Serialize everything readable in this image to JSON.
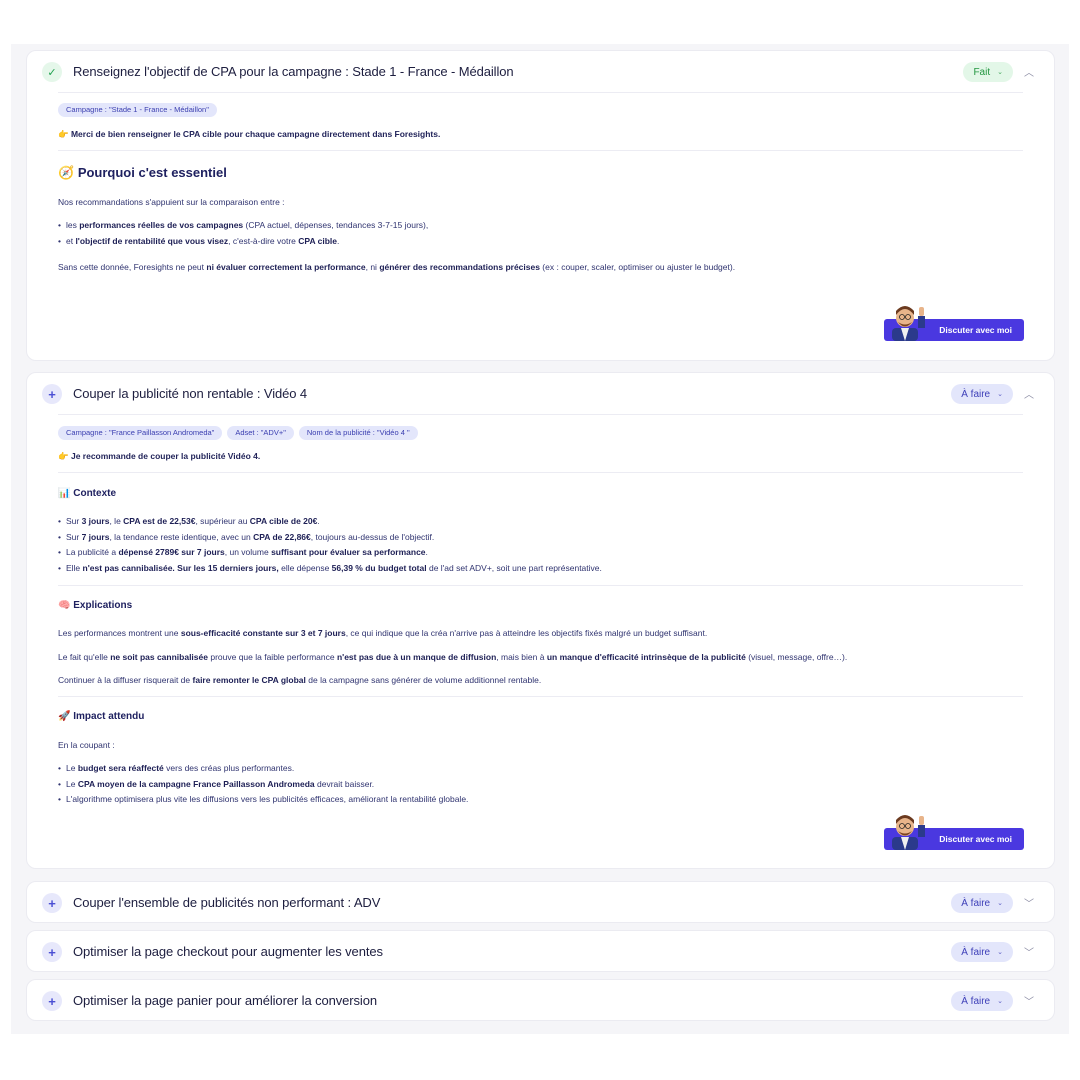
{
  "cards": [
    {
      "title": "Renseignez l'objectif de CPA pour la campagne : Stade 1 - France - Médaillon",
      "status": "Fait",
      "tags": [
        "Campagne : \"Stade 1 - France - Médaillon\""
      ],
      "lead_icon": "👉",
      "lead": "Merci de bien renseigner le CPA cible pour chaque campagne directement dans Foresights.",
      "section_icon": "🧭",
      "section_title": "Pourquoi c'est essentiel",
      "intro": "Nos recommandations s'appuient sur la comparaison entre :",
      "bullets": [
        [
          "les ",
          "performances réelles de vos campagnes",
          " (CPA actuel, dépenses, tendances 3-7-15 jours),"
        ],
        [
          "et ",
          "l'objectif de rentabilité que vous visez",
          ", c'est-à-dire votre ",
          "CPA cible",
          "."
        ]
      ],
      "outro": [
        "Sans cette donnée, Foresights ne peut ",
        "ni évaluer correctement la performance",
        ", ni ",
        "générer des recommandations précises",
        " (ex : couper, scaler, optimiser ou ajuster le budget)."
      ],
      "chat_label": "Discuter avec moi"
    },
    {
      "title": "Couper la publicité non rentable : Vidéo 4",
      "status": "À faire",
      "tags": [
        "Campagne : \"France Paillasson Andromeda\"",
        "Adset : \"ADV+\"",
        "Nom de la publicité : \"Vidéo 4 \""
      ],
      "lead_icon": "👉",
      "lead": "Je recommande de couper la publicité Vidéo 4.",
      "contexte": {
        "icon": "📊",
        "title": "Contexte",
        "bullets": [
          [
            "Sur ",
            "3 jours",
            ", le ",
            "CPA est de 22,53€",
            ", supérieur au ",
            "CPA cible de 20€",
            "."
          ],
          [
            "Sur ",
            "7 jours",
            ", la tendance reste identique, avec un ",
            "CPA de 22,86€",
            ", toujours au-dessus de l'objectif."
          ],
          [
            "La publicité a ",
            "dépensé 2789€ sur 7 jours",
            ", un volume ",
            "suffisant pour évaluer sa performance",
            "."
          ],
          [
            "Elle ",
            "n'est pas cannibalisée. Sur les 15 derniers jours,",
            " elle dépense ",
            "56,39 % du budget total",
            " de l'ad set ADV+, soit une part représentative."
          ]
        ]
      },
      "explications": {
        "icon": "🧠",
        "title": "Explications",
        "paragraphs": [
          [
            "Les performances montrent une ",
            "sous-efficacité constante sur 3 et 7 jours",
            ", ce qui indique que la créa n'arrive pas à atteindre les objectifs fixés malgré un budget suffisant."
          ],
          [
            "Le fait qu'elle ",
            "ne soit pas cannibalisée",
            " prouve que la faible performance ",
            "n'est pas due à un manque de diffusion",
            ", mais bien à ",
            "un manque d'efficacité intrinsèque de la publicité",
            " (visuel, message, offre…)."
          ],
          [
            "Continuer à la diffuser risquerait de ",
            "faire remonter le CPA global",
            " de la campagne sans générer de volume additionnel rentable."
          ]
        ]
      },
      "impact": {
        "icon": "🚀",
        "title": "Impact attendu",
        "intro": "En la coupant :",
        "bullets": [
          [
            "Le ",
            "budget sera réaffecté",
            " vers des créas plus performantes."
          ],
          [
            "Le ",
            "CPA moyen de la campagne France Paillasson Andromeda",
            " devrait baisser."
          ],
          [
            "L'algorithme optimisera plus vite les diffusions vers les publicités efficaces, améliorant la rentabilité globale."
          ]
        ]
      },
      "chat_label": "Discuter avec moi"
    },
    {
      "title": "Couper l'ensemble de publicités non performant : ADV",
      "status": "À faire"
    },
    {
      "title": "Optimiser la page checkout pour augmenter les ventes",
      "status": "À faire"
    },
    {
      "title": "Optimiser la page panier pour améliorer la conversion",
      "status": "À faire"
    }
  ],
  "colors": {
    "accent": "#4a38e0",
    "done": "#22963f",
    "todo_pill": "#e3e6fb"
  }
}
